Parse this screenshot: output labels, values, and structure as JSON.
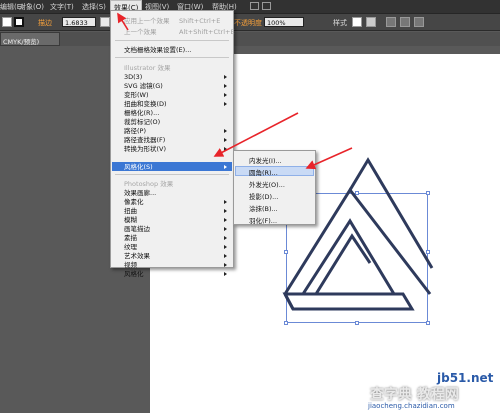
{
  "menubar": {
    "items": [
      "编辑(E)",
      "对象(O)",
      "文字(T)",
      "选择(S)",
      "效果(C)",
      "视图(V)",
      "窗口(W)",
      "帮助(H)"
    ]
  },
  "control": {
    "label_stroke": "描边",
    "stroke_value": "1.6833",
    "label_opacity": "不透明度",
    "opacity_value": "100%",
    "label_style": "样式"
  },
  "document_tab": "CMYK/预览)",
  "effect_menu": {
    "apply_last": "应用上一个效果",
    "apply_last_shortcut": "Shift+Ctrl+E",
    "last_effect": "上一个效果",
    "last_effect_shortcut": "Alt+Shift+Ctrl+E",
    "raster_settings": "文档栅格效果设置(E)...",
    "illustrator_section": "Illustrator 效果",
    "illustrator_items": [
      "3D(3)",
      "SVG 滤镜(G)",
      "变形(W)",
      "扭曲和变换(D)",
      "栅格化(R)...",
      "裁剪标记(O)",
      "路径(P)",
      "路径查找器(F)",
      "转换为形状(V)",
      "风格化(S)"
    ],
    "photoshop_section": "Photoshop 效果",
    "photoshop_items": [
      "效果画廊...",
      "像素化",
      "扭曲",
      "模糊",
      "画笔描边",
      "素描",
      "纹理",
      "艺术效果",
      "视频",
      "风格化"
    ]
  },
  "stylize_submenu": {
    "items": [
      "内发光(I)...",
      "圆角(R)...",
      "外发光(O)...",
      "投影(D)...",
      "涂抹(B)...",
      "羽化(F)..."
    ],
    "highlighted": "圆角(R)..."
  },
  "watermark": {
    "line1": "jb51.net",
    "line2": "查字典 教程网",
    "line3": "jiaocheng.chazidian.com"
  },
  "colors": {
    "accent_orange": "#f7a13b",
    "arrow_red": "#e8242a",
    "menu_highlight": "#3b77d4",
    "selection_blue": "#6b8ad6",
    "shape_stroke": "#2e3a5c"
  }
}
